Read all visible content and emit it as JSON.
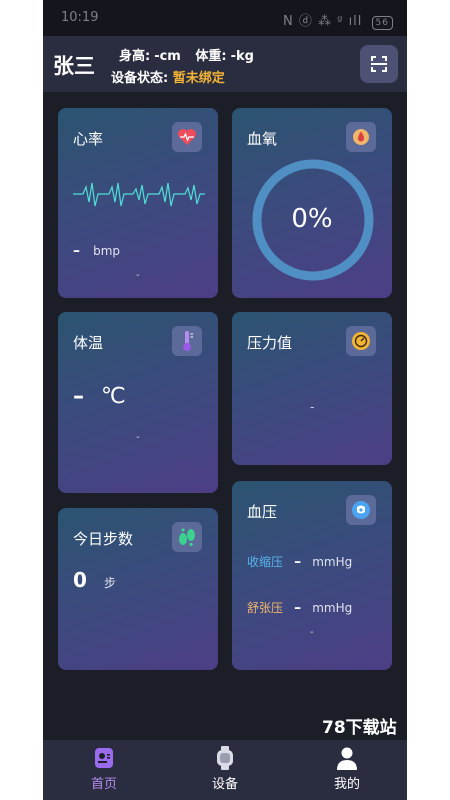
{
  "status_bar": {
    "time": "10:19",
    "signal_text": "N ⓓ ⁂ ᵍ ıll",
    "battery": "56"
  },
  "header": {
    "user_name": "张三",
    "height_label": "身高:",
    "height_value": "-cm",
    "weight_label": "体重:",
    "weight_value": "-kg",
    "device_label": "设备状态:",
    "device_status": "暂未绑定"
  },
  "cards": {
    "heart_rate": {
      "title": "心率",
      "value": "–",
      "unit": "bmp",
      "footer": "-"
    },
    "blood_oxygen": {
      "title": "血氧",
      "value": "0%",
      "progress_fraction": 0
    },
    "temperature": {
      "title": "体温",
      "value": "–",
      "unit": "℃",
      "footer": "-"
    },
    "pressure": {
      "title": "压力值",
      "value": "-"
    },
    "steps": {
      "title": "今日步数",
      "value": "0",
      "unit": "步"
    },
    "blood_pressure": {
      "title": "血压",
      "systolic_label": "收缩压",
      "systolic_value": "–",
      "systolic_unit": "mmHg",
      "diastolic_label": "舒张压",
      "diastolic_value": "–",
      "diastolic_unit": "mmHg",
      "footer": "-"
    }
  },
  "nav": {
    "items": [
      {
        "label": "首页",
        "active": true
      },
      {
        "label": "设备",
        "active": false
      },
      {
        "label": "我的",
        "active": false
      }
    ]
  },
  "watermark": "78下载站",
  "colors": {
    "accent_yellow": "#f3b335",
    "active_nav": "#b58cf0",
    "systolic": "#5ab4f0",
    "diastolic": "#f2b66a",
    "heart_line": "#4fe0d6"
  },
  "icons": {
    "header_action": "scan-icon",
    "heart_rate": "heart-icon",
    "blood_oxygen": "drop-icon",
    "temperature": "thermometer-icon",
    "pressure": "gauge-icon",
    "steps": "footprints-icon",
    "blood_pressure": "bp-icon"
  }
}
